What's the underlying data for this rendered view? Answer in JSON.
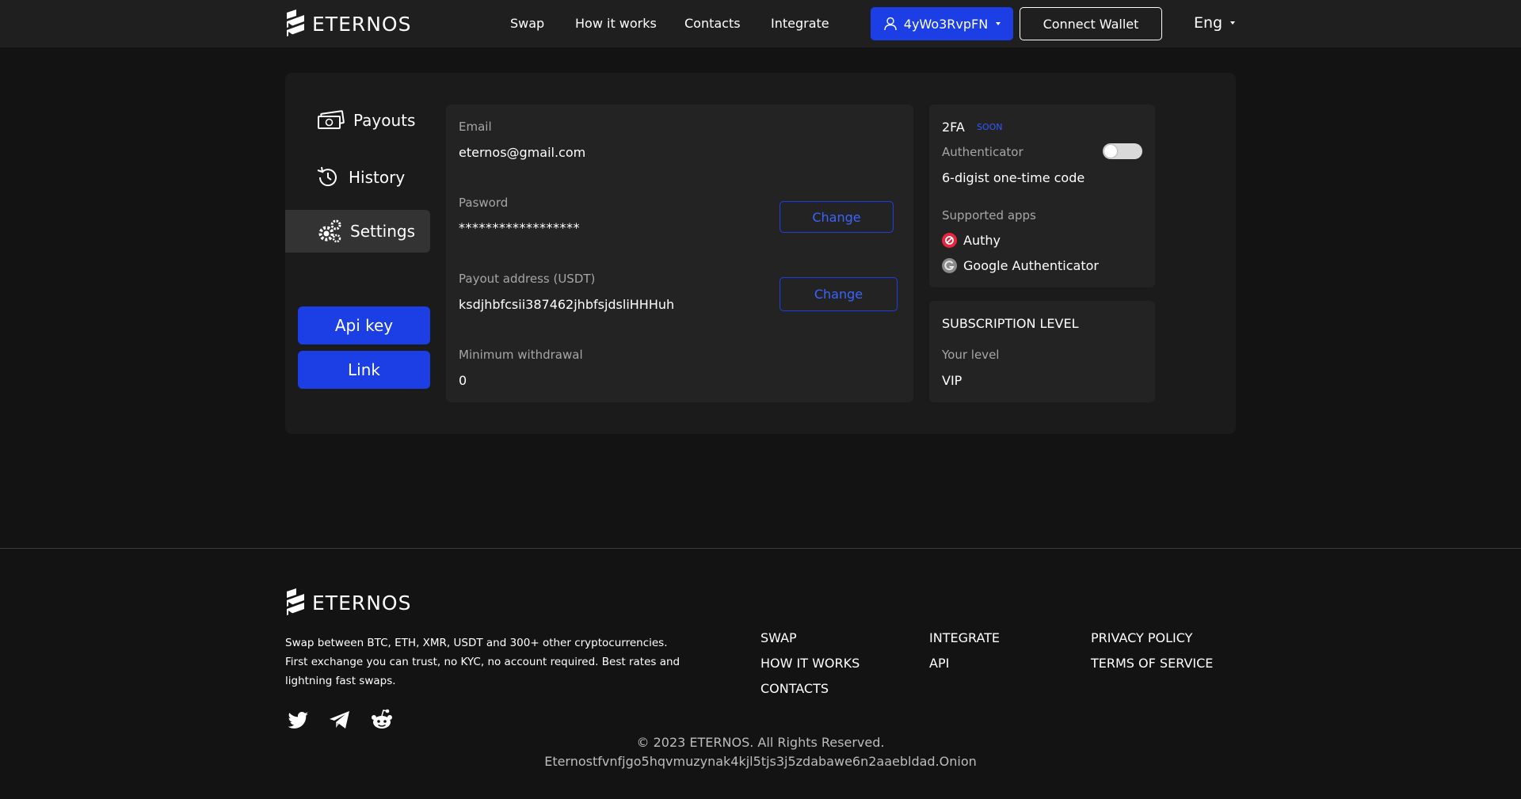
{
  "header": {
    "brand": "ETERNOS",
    "nav": [
      "Swap",
      "How it works",
      "Contacts",
      "Integrate"
    ],
    "account_label": "4yWo3RvpFN",
    "connect_label": "Connect Wallet",
    "language": "Eng"
  },
  "sidebar": {
    "items": [
      {
        "label": "Payouts",
        "icon": "money-icon"
      },
      {
        "label": "History",
        "icon": "history-icon"
      },
      {
        "label": "Settings",
        "icon": "gears-icon"
      }
    ],
    "active": "Settings",
    "api_key_label": "Api key",
    "link_label": "Link"
  },
  "account": {
    "email_label": "Email",
    "email_value": "eternos@gmail.com",
    "password_label": "Pasword",
    "password_value": "******************",
    "payout_label": "Payout address (USDT)",
    "payout_value": "ksdjhbfcsii387462jhbfsjdsliHHHuh",
    "change_label": "Change",
    "min_label": "Minimum withdrawal",
    "min_value": "0"
  },
  "twofa": {
    "title": "2FA",
    "soon": "SOON",
    "auth_label": "Authenticator",
    "auth_enabled": false,
    "code_desc": "6-digist one-time code",
    "apps_label": "Supported apps",
    "apps": [
      "Authy",
      "Google Authenticator"
    ]
  },
  "subscription": {
    "title": "SUBSCRIPTION LEVEL",
    "level_label": "Your level",
    "level_value": "VIP"
  },
  "footer": {
    "brand": "ETERNOS",
    "description": "Swap between BTC, ETH, XMR, USDT and 300+ other cryptocurrencies. First exchange you can trust, no KYC, no account required. Best rates and lightning fast swaps.",
    "col1": [
      "SWAP",
      "HOW IT WORKS",
      "CONTACTS"
    ],
    "col2": [
      "INTEGRATE",
      "API"
    ],
    "col3": [
      "PRIVACY POLICY",
      "TERMS OF SERVICE"
    ],
    "social": [
      "twitter-icon",
      "telegram-icon",
      "reddit-icon"
    ],
    "copyright": "© 2023 ETERNOS. All Rights Reserved.",
    "onion": "Eternostfvnfjgo5hqvmuzynak4kjl5tjs3j5zdabawe6n2aaebldad.Onion"
  },
  "colors": {
    "accent": "#1c3fe5",
    "background": "#131313",
    "header": "#1f1f1f",
    "panel": "#1b1b1b",
    "card": "#232323"
  }
}
